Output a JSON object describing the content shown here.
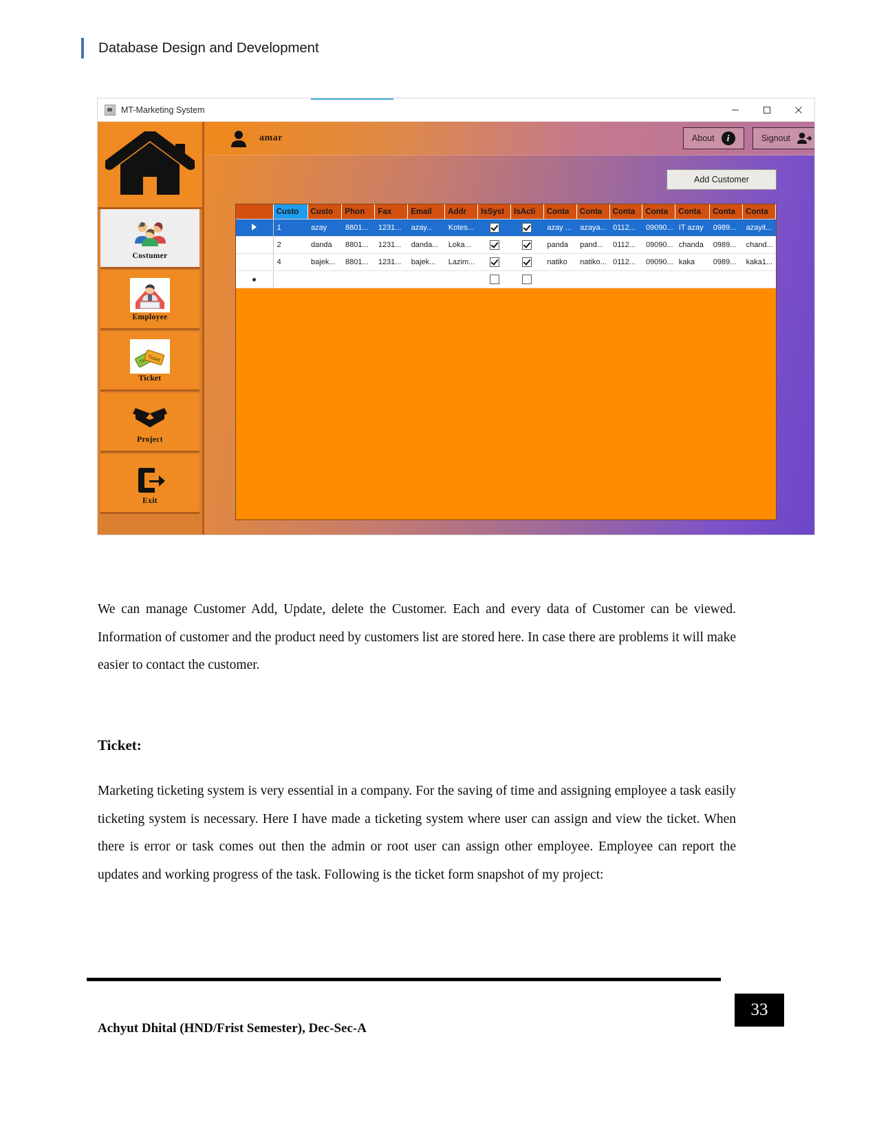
{
  "document": {
    "header_title": "Database Design and Development",
    "paragraph_1": "We can manage Customer Add, Update, delete the Customer. Each and every data of Customer can be viewed. Information of customer and the product need by customers list are stored here. In case there are problems it will make easier to contact the customer.",
    "section_heading": "Ticket:",
    "paragraph_2": "Marketing ticketing system is very essential in a company. For the saving of time and assigning employee a task easily ticketing system is necessary. Here I have made a ticketing system where user can assign and view the ticket. When there is error or task comes out then the admin or root user can assign other employee. Employee can report the updates and working progress of the task. Following is the ticket form snapshot of my project:",
    "page_number": "33",
    "footer": "Achyut Dhital (HND/Frist Semester), Dec-Sec-A"
  },
  "screenshot": {
    "window": {
      "title": "MT-Marketing System",
      "icon": "app-icon",
      "controls": {
        "minimize": "minimize-icon",
        "maximize": "maximize-icon",
        "close": "close-icon"
      }
    },
    "topbar": {
      "user_icon": "user-avatar-icon",
      "user_name": "amar",
      "about_label": "About",
      "about_icon": "info-icon",
      "signout_label": "Signout",
      "signout_icon": "signout-user-icon"
    },
    "sidebar": {
      "home_icon": "home-icon",
      "items": [
        {
          "label": "Costumer",
          "icon": "people-group-icon",
          "selected": true
        },
        {
          "label": "Employee",
          "icon": "employee-icon",
          "selected": false
        },
        {
          "label": "Ticket",
          "icon": "ticket-icon",
          "selected": false
        },
        {
          "label": "Project",
          "icon": "open-box-icon",
          "selected": false
        },
        {
          "label": "Exit",
          "icon": "exit-door-icon",
          "selected": false
        }
      ]
    },
    "content": {
      "add_customer_label": "Add Customer",
      "grid": {
        "columns": [
          {
            "label": "",
            "key": "rowmark",
            "selected": false
          },
          {
            "label": "Custo",
            "key": "c1",
            "selected": true
          },
          {
            "label": "Custo",
            "key": "c2",
            "selected": false
          },
          {
            "label": "Phon",
            "key": "c3",
            "selected": false
          },
          {
            "label": "Fax",
            "key": "c4",
            "selected": false
          },
          {
            "label": "Email",
            "key": "c5",
            "selected": false
          },
          {
            "label": "Addr",
            "key": "c6",
            "selected": false
          },
          {
            "label": "IsSyst",
            "key": "c7",
            "selected": false
          },
          {
            "label": "IsActi",
            "key": "c8",
            "selected": false
          },
          {
            "label": "Conta",
            "key": "c9",
            "selected": false
          },
          {
            "label": "Conta",
            "key": "c10",
            "selected": false
          },
          {
            "label": "Conta",
            "key": "c11",
            "selected": false
          },
          {
            "label": "Conta",
            "key": "c12",
            "selected": false
          },
          {
            "label": "Conta",
            "key": "c13",
            "selected": false
          },
          {
            "label": "Conta",
            "key": "c14",
            "selected": false
          },
          {
            "label": "Conta",
            "key": "c15",
            "selected": false
          }
        ],
        "rows": [
          {
            "selected": true,
            "marker": "row-selector-arrow",
            "c1": "1",
            "c2": "azay",
            "c3": "8801...",
            "c4": "1231...",
            "c5": "azay...",
            "c6": "Kotes...",
            "c7": true,
            "c8": true,
            "c9": "azay ...",
            "c10": "azaya...",
            "c11": "0112...",
            "c12": "09090...",
            "c13": "IT azay",
            "c14": "0989...",
            "c15": "azayit..."
          },
          {
            "selected": false,
            "marker": "",
            "c1": "2",
            "c2": "danda",
            "c3": "8801...",
            "c4": "1231...",
            "c5": "danda...",
            "c6": "Loka...",
            "c7": true,
            "c8": true,
            "c9": "panda",
            "c10": "pand...",
            "c11": "0112...",
            "c12": "09090...",
            "c13": "chanda",
            "c14": "0989...",
            "c15": "chand..."
          },
          {
            "selected": false,
            "marker": "",
            "c1": "4",
            "c2": "bajek...",
            "c3": "8801...",
            "c4": "1231...",
            "c5": "bajek...",
            "c6": "Lazim...",
            "c7": true,
            "c8": true,
            "c9": "natiko",
            "c10": "natiko...",
            "c11": "0112...",
            "c12": "09090...",
            "c13": "kaka",
            "c14": "0989...",
            "c15": "kaka1..."
          },
          {
            "selected": false,
            "marker": "new-row-dot",
            "c1": "",
            "c2": "",
            "c3": "",
            "c4": "",
            "c5": "",
            "c6": "",
            "c7": false,
            "c8": false,
            "c9": "",
            "c10": "",
            "c11": "",
            "c12": "",
            "c13": "",
            "c14": "",
            "c15": ""
          }
        ]
      }
    },
    "colors": {
      "accent_orange": "#ef8b22",
      "grid_header": "#d4500f",
      "selection_blue": "#1f6fd0",
      "header_selected": "#1f9cf0",
      "gradient_purple": "#6d45c9"
    }
  }
}
